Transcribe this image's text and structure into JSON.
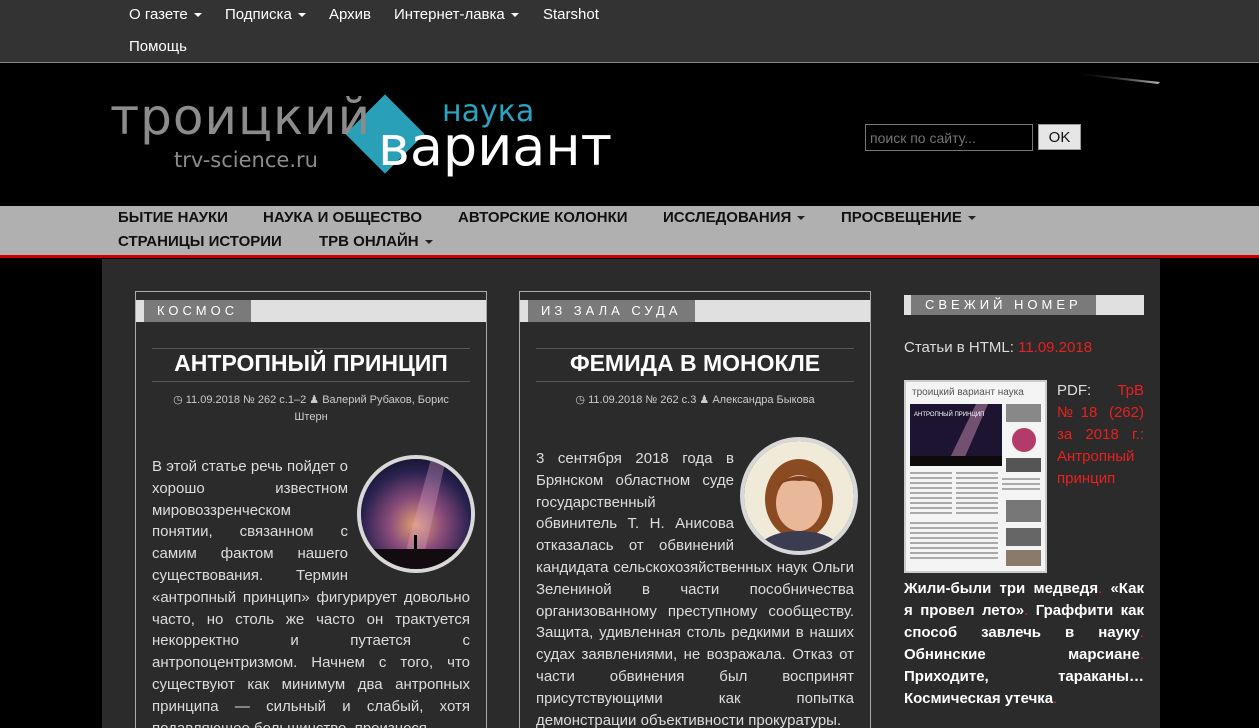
{
  "top_nav": {
    "items": [
      {
        "label": "О газете",
        "dropdown": true
      },
      {
        "label": "Подписка",
        "dropdown": true
      },
      {
        "label": "Архив",
        "dropdown": false
      },
      {
        "label": "Интернет-лавка",
        "dropdown": true
      },
      {
        "label": "Starshot",
        "dropdown": false
      },
      {
        "label": "Помощь",
        "dropdown": false
      }
    ]
  },
  "header": {
    "logo_main": "троицкий",
    "logo_site": "trv-science.ru",
    "logo_nauka": "наука",
    "logo_variant": "вариант",
    "search_placeholder": "поиск по сайту...",
    "search_button": "OK"
  },
  "main_nav": {
    "items": [
      {
        "label": "БЫТИЕ НАУКИ",
        "dropdown": false
      },
      {
        "label": "НАУКА И ОБЩЕСТВО",
        "dropdown": false
      },
      {
        "label": "АВТОРСКИЕ КОЛОНКИ",
        "dropdown": false
      },
      {
        "label": "ИССЛЕДОВАНИЯ",
        "dropdown": true
      },
      {
        "label": "ПРОСВЕЩЕНИЕ",
        "dropdown": true
      },
      {
        "label": "СТРАНИЦЫ ИСТОРИИ",
        "dropdown": false
      },
      {
        "label": "ТРВ ОНЛАЙН",
        "dropdown": true
      }
    ]
  },
  "articles": [
    {
      "category": "КОСМОС",
      "title": "АНТРОПНЫЙ ПРИНЦИП",
      "meta_issue": "11.09.2018 № 262 с.1–2",
      "meta_authors": "Валерий Рубаков, Борис Штерн",
      "thumb_icon": "milky-way-photo",
      "body": "В этой статье речь пойдет о хорошо известном мировоззренческом понятии, связанном с самим фактом нашего существования. Термин «антропный принцип» фигурирует довольно часто, но столь же часто он трактуется некорректно и путается с антропоцентризмом. Начнем с того, что существуют как минимум два антропных принципа — сильный и слабый, хотя подавляющее большинство, произнося"
    },
    {
      "category": "ИЗ ЗАЛА СУДА",
      "title": "ФЕМИДА В МОНОКЛЕ",
      "meta_issue": "11.09.2018 № 262 с.3",
      "meta_authors": "Александра Быкова",
      "thumb_icon": "portrait-photo",
      "body": "3 сентября 2018 года в Брянском областном суде государственный обвинитель Т. Н. Анисова отказалась от обвинений кандидата сельскохозяйственных наук Ольги Зелениной в части пособничества организованному преступному сообществу. Защита, удивленная столь редкими в наших судах заявлениями, не возражала. Отказ от части обвинения был воспринят присутствующими как попытка демонстрации объективности прокуратуры."
    }
  ],
  "sidebar": {
    "header": "СВЕЖИЙ НОМЕР",
    "html_prefix": "Статьи в HTML: ",
    "html_date": "11.09.2018",
    "pdf_prefix": "PDF: ",
    "pdf_link": "ТрВ №18 (262) за 2018 г.: Антропный принцип",
    "teaser": [
      {
        "text": "Жили-были три медведя",
        "red": false
      },
      {
        "text": ". ",
        "red": true
      },
      {
        "text": "«Как я провел лето»",
        "red": false
      },
      {
        "text": ". ",
        "red": true
      },
      {
        "text": "Граффити как способ завлечь в науку",
        "red": false
      },
      {
        "text": ". ",
        "red": true
      },
      {
        "text": "Обнинские марсиане",
        "red": false
      },
      {
        "text": ". ",
        "red": true
      },
      {
        "text": "Приходите, тараканы…",
        "red": false
      },
      {
        "text": " ",
        "red": true
      },
      {
        "text": "Космическая утечка",
        "red": false
      },
      {
        "text": ".",
        "red": true
      }
    ],
    "cover_masthead": "троицкий вариант наука",
    "cover_headline": "АНТРОПНЫЙ ПРИНЦИП"
  },
  "colors": {
    "accent_red": "#e8201f",
    "logo_teal": "#2aa4c0",
    "nav_gray": "#b0b0b0",
    "content_bg": "#2b2b2b"
  }
}
